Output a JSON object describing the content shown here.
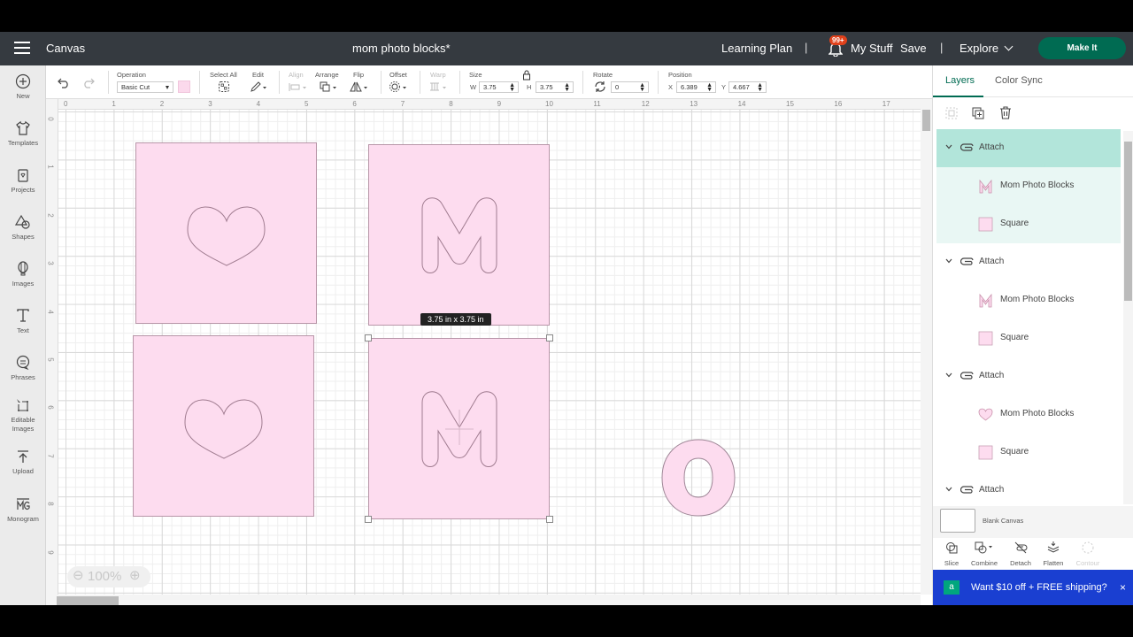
{
  "header": {
    "app_title": "Canvas",
    "doc_title": "mom photo blocks*",
    "learning_plan": "Learning Plan",
    "notification_count": "99+",
    "my_stuff": "My Stuff",
    "save": "Save",
    "explore": "Explore",
    "make_it": "Make It",
    "separator": "|"
  },
  "toolbar": {
    "operation_label": "Operation",
    "operation_value": "Basic Cut",
    "operation_color": "#fbd9ec",
    "select_all": "Select All",
    "edit": "Edit",
    "align": "Align",
    "arrange": "Arrange",
    "flip": "Flip",
    "offset": "Offset",
    "warp": "Warp",
    "size_label": "Size",
    "w_label": "W",
    "w_value": "3.75",
    "h_label": "H",
    "h_value": "3.75",
    "rotate_label": "Rotate",
    "rotate_value": "0",
    "position_label": "Position",
    "x_label": "X",
    "x_value": "6.389",
    "y_label": "Y",
    "y_value": "4.667"
  },
  "sidebar": {
    "items": [
      {
        "label": "New",
        "icon": "plus-circle-icon"
      },
      {
        "label": "Templates",
        "icon": "tshirt-icon"
      },
      {
        "label": "Projects",
        "icon": "projects-icon"
      },
      {
        "label": "Shapes",
        "icon": "shapes-icon"
      },
      {
        "label": "Images",
        "icon": "balloon-icon"
      },
      {
        "label": "Text",
        "icon": "text-icon"
      },
      {
        "label": "Phrases",
        "icon": "speech-bubble-icon"
      },
      {
        "label": "Editable Images",
        "icon": "editable-image-icon"
      },
      {
        "label": "Upload",
        "icon": "upload-icon"
      },
      {
        "label": "Monogram",
        "icon": "monogram-icon"
      }
    ]
  },
  "canvas": {
    "ruler_top": [
      "0",
      "1",
      "2",
      "3",
      "4",
      "5",
      "6",
      "7",
      "8",
      "9",
      "10",
      "11",
      "12",
      "13",
      "14",
      "15",
      "16",
      "17"
    ],
    "ruler_left": [
      "0",
      "1",
      "2",
      "3",
      "4",
      "5",
      "6",
      "7",
      "8",
      "9"
    ],
    "size_tooltip": "3.75  in x 3.75  in",
    "zoom_level": "100%",
    "block_color": "#fddcef"
  },
  "panel": {
    "tabs": [
      "Layers",
      "Color Sync"
    ],
    "layers": [
      {
        "type": "group",
        "label": "Attach",
        "selected": true
      },
      {
        "type": "child",
        "label": "Mom Photo Blocks",
        "thumb": "M",
        "selected": true
      },
      {
        "type": "child",
        "label": "Square",
        "thumb": "square",
        "selected": true
      },
      {
        "type": "group",
        "label": "Attach"
      },
      {
        "type": "child",
        "label": "Mom Photo Blocks",
        "thumb": "M"
      },
      {
        "type": "child",
        "label": "Square",
        "thumb": "square"
      },
      {
        "type": "group",
        "label": "Attach"
      },
      {
        "type": "child",
        "label": "Mom Photo Blocks",
        "thumb": "heart"
      },
      {
        "type": "child",
        "label": "Square",
        "thumb": "square"
      },
      {
        "type": "group",
        "label": "Attach"
      }
    ],
    "blank_canvas": "Blank Canvas",
    "actions": [
      "Slice",
      "Combine",
      "Detach",
      "Flatten",
      "Contour"
    ],
    "promo": "Want $10 off + FREE shipping?",
    "promo_close": "×",
    "accent": "#006b52"
  }
}
